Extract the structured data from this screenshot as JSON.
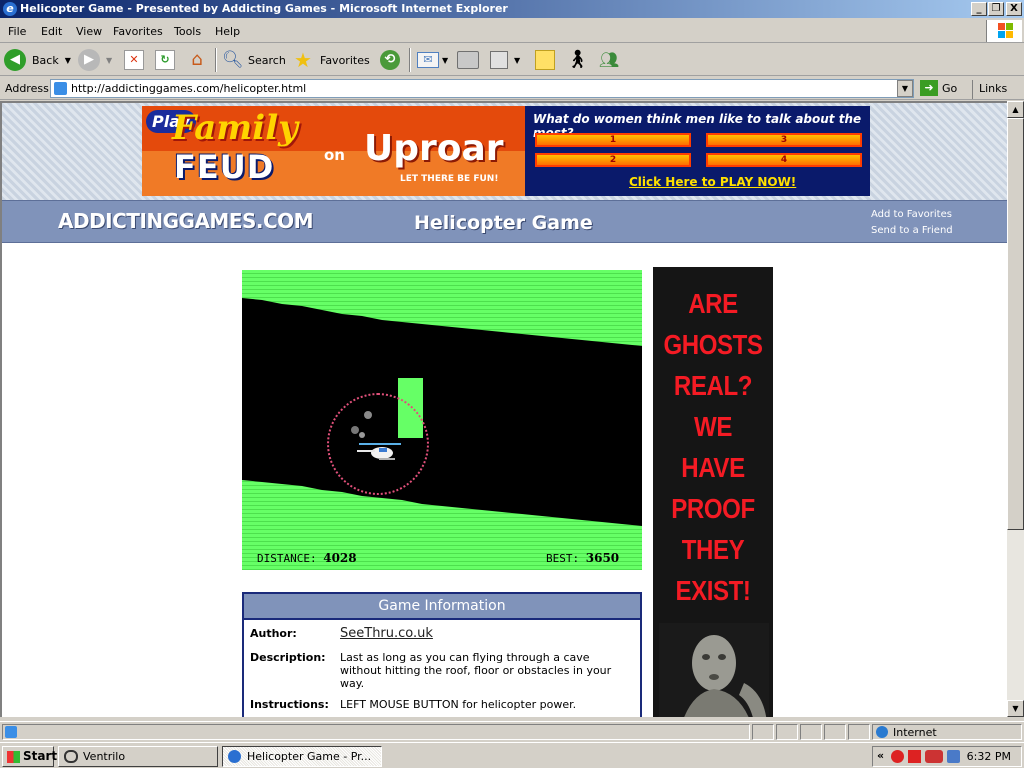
{
  "window": {
    "title": "Helicopter Game - Presented by Addicting Games - Microsoft Internet Explorer",
    "min_label": "_",
    "max_label": "❐",
    "close_label": "X"
  },
  "menu": [
    "File",
    "Edit",
    "View",
    "Favorites",
    "Tools",
    "Help"
  ],
  "toolbar": {
    "back": "Back",
    "search": "Search",
    "favorites": "Favorites"
  },
  "address": {
    "label": "Address",
    "url": "http://addictinggames.com/helicopter.html",
    "go": "Go",
    "links": "Links"
  },
  "banner": {
    "play": "Play",
    "family": "Family",
    "feud": "FEUD",
    "on": "on",
    "uproar": "Uproar",
    "tagline": "LET THERE BE FUN!",
    "question": "What do women think men like to talk about the most?",
    "answers": [
      "1",
      "3",
      "2",
      "4"
    ],
    "cta": "Click Here to PLAY NOW!"
  },
  "site": {
    "logo": "ADDICTINGGAMES.COM",
    "title": "Helicopter Game",
    "links": [
      "Add to Favorites",
      "Send to a Friend"
    ]
  },
  "game": {
    "distance_label": "DISTANCE:",
    "distance": "4028",
    "best_label": "BEST:",
    "best": "3650",
    "colors": {
      "wall": "#66ff66",
      "cave": "#000000",
      "ring": "#e0507a"
    }
  },
  "info": {
    "header": "Game Information",
    "author_label": "Author:",
    "author": "SeeThru.co.uk",
    "description_label": "Description:",
    "description": "Last as long as you can flying through a cave without hitting the roof, floor or obstacles in your way.",
    "instructions_label": "Instructions:",
    "instructions": "LEFT MOUSE BUTTON for helicopter power."
  },
  "ad": {
    "lines": [
      "ARE",
      "GHOSTS",
      "REAL?",
      "WE",
      "HAVE",
      "PROOF",
      "THEY",
      "EXIST!"
    ]
  },
  "status": {
    "zone": "Internet"
  },
  "taskbar": {
    "start": "Start",
    "tasks": [
      "Ventrilo",
      "Helicopter Game - Pr..."
    ],
    "clock": "6:32 PM"
  }
}
